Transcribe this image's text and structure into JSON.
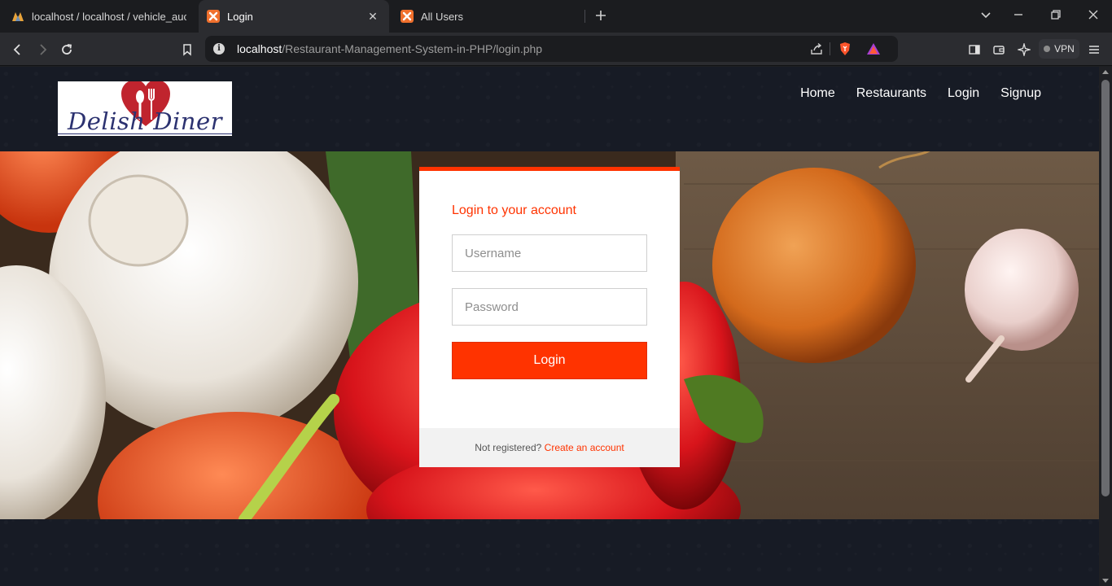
{
  "browser": {
    "tabs": [
      {
        "title": "localhost / localhost / vehicle_auctio"
      },
      {
        "title": "Login",
        "close": "✕"
      },
      {
        "title": "All Users"
      }
    ],
    "url_host": "localhost",
    "url_path": "/Restaurant-Management-System-in-PHP/login.php",
    "vpn_label": "VPN"
  },
  "site": {
    "brand": "Delish Diner",
    "nav": [
      "Home",
      "Restaurants",
      "Login",
      "Signup"
    ]
  },
  "login": {
    "heading": "Login to your account",
    "username_placeholder": "Username",
    "password_placeholder": "Password",
    "button": "Login",
    "footer_text": "Not registered?",
    "footer_link": "Create an account"
  },
  "colors": {
    "accent": "#ff3300",
    "page_bg": "#171b25",
    "brand_text": "#2c3270",
    "heart": "#c0242e"
  }
}
